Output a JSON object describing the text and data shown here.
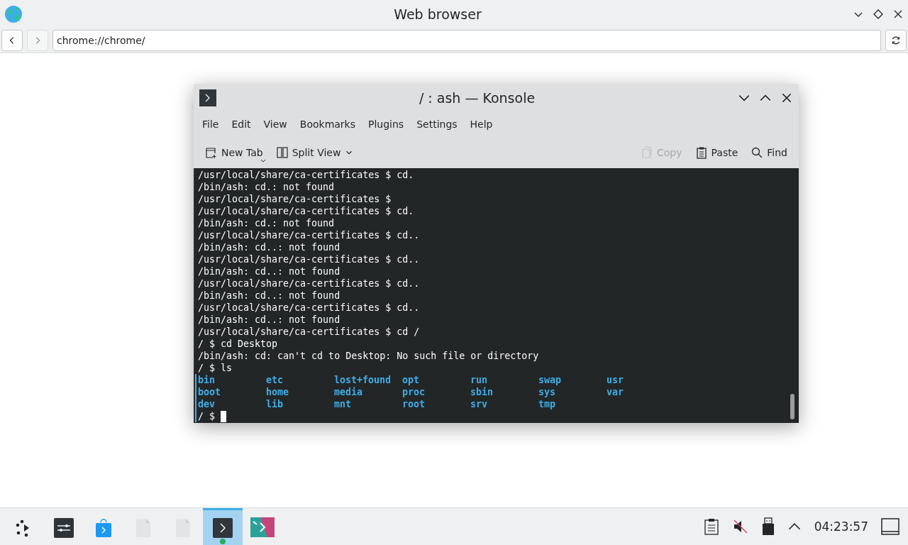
{
  "browser": {
    "title": "Web browser",
    "url": "chrome://chrome/"
  },
  "konsole": {
    "title": "/ : ash — Konsole",
    "menu": [
      "File",
      "Edit",
      "View",
      "Bookmarks",
      "Plugins",
      "Settings",
      "Help"
    ],
    "toolbar": [
      {
        "kind": "new-tab",
        "label": "New Tab",
        "disabled": false
      },
      {
        "kind": "split-view",
        "label": "Split View",
        "disabled": false
      },
      {
        "kind": "copy",
        "label": "Copy",
        "disabled": true
      },
      {
        "kind": "paste",
        "label": "Paste",
        "disabled": false
      },
      {
        "kind": "find",
        "label": "Find",
        "disabled": false
      }
    ],
    "lines": [
      "/usr/local/share/ca-certificates $ cd.",
      "/bin/ash: cd.: not found",
      "/usr/local/share/ca-certificates $",
      "/usr/local/share/ca-certificates $ cd.",
      "/bin/ash: cd.: not found",
      "/usr/local/share/ca-certificates $ cd..",
      "/bin/ash: cd..: not found",
      "/usr/local/share/ca-certificates $ cd..",
      "/bin/ash: cd..: not found",
      "/usr/local/share/ca-certificates $ cd..",
      "/bin/ash: cd..: not found",
      "/usr/local/share/ca-certificates $ cd..",
      "/bin/ash: cd..: not found",
      "/usr/local/share/ca-certificates $ cd /",
      "/ $ cd Desktop",
      "/bin/ash: cd: can't cd to Desktop: No such file or directory",
      "/ $ ls"
    ],
    "listing": [
      "bin",
      "boot",
      "dev",
      "etc",
      "home",
      "lib",
      "lost+found",
      "media",
      "mnt",
      "opt",
      "proc",
      "root",
      "run",
      "sbin",
      "srv",
      "swap",
      "sys",
      "tmp",
      "usr",
      "var"
    ],
    "prompt": "/ $"
  },
  "taskbar": {
    "apps": [
      {
        "kind": "launcher",
        "selected": false
      },
      {
        "kind": "settings",
        "selected": false
      },
      {
        "kind": "store",
        "selected": false
      },
      {
        "kind": "file",
        "selected": false
      },
      {
        "kind": "file",
        "selected": false
      },
      {
        "kind": "terminal",
        "selected": true
      },
      {
        "kind": "app",
        "selected": false
      }
    ],
    "clock": "04:23:57"
  }
}
